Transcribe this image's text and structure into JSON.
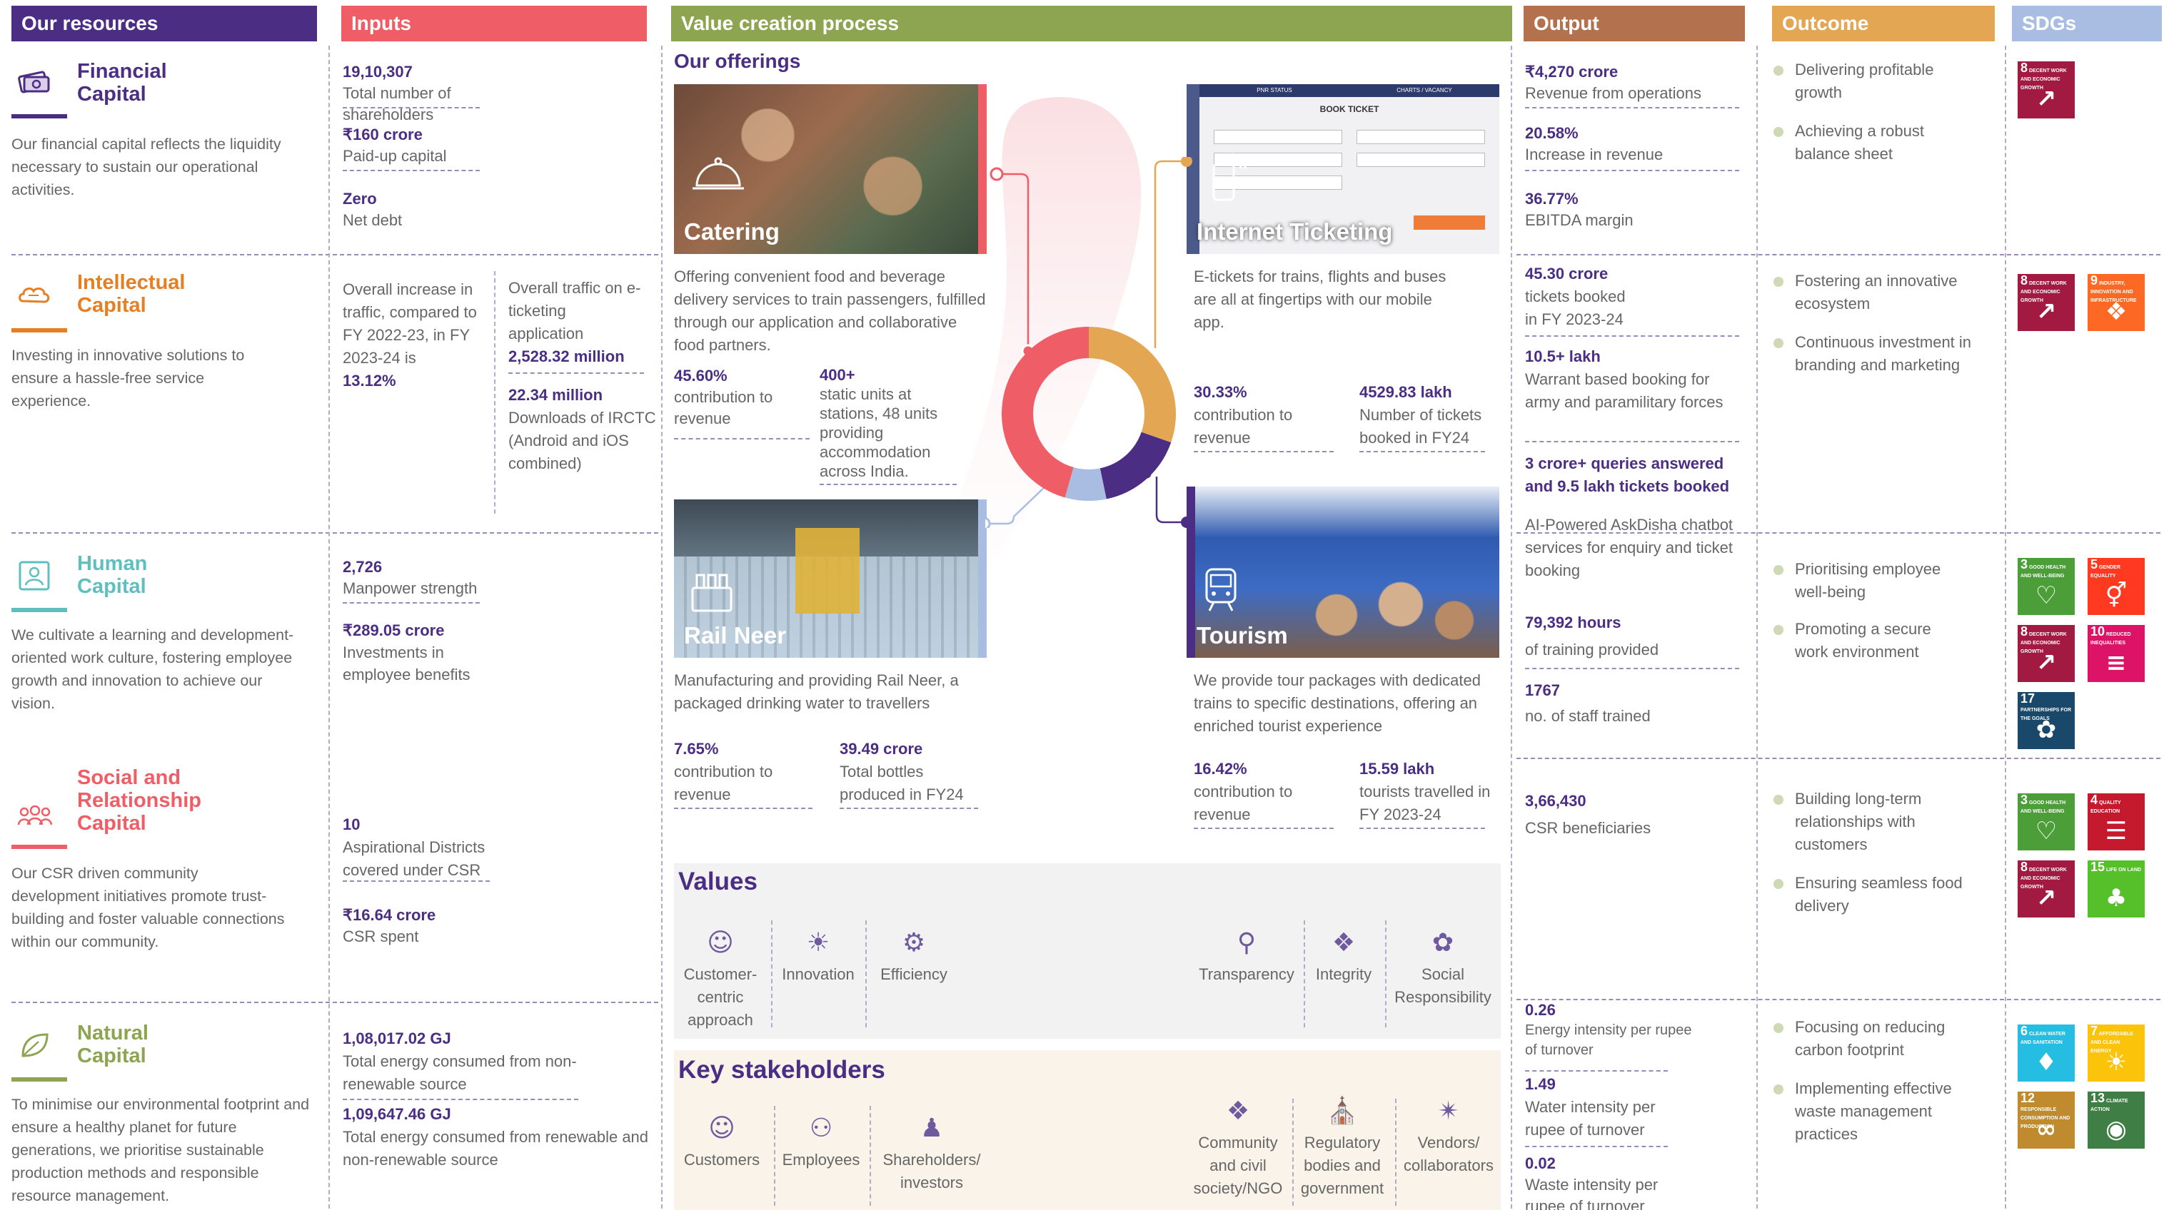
{
  "headers": {
    "resources": "Our resources",
    "inputs": "Inputs",
    "value": "Value creation process",
    "output": "Output",
    "outcome": "Outcome",
    "sdgs": "SDGs"
  },
  "offerings_title": "Our offerings",
  "colors": {
    "purple": "#4b2e83",
    "red": "#ef5d66",
    "green": "#8da550",
    "brown": "#b3714e",
    "orange": "#e3a653",
    "blue": "#a9bde3"
  },
  "capitals": [
    {
      "title": "Financial Capital",
      "desc": "Our financial capital reflects the liquidity necessary to sustain our operational activities.",
      "color": "#4b2e83",
      "icon": "money-icon"
    },
    {
      "title": "Intellectual Capital",
      "desc": "Investing in innovative solutions to ensure a hassle-free service experience.",
      "color": "#e67e22",
      "icon": "brain-icon"
    },
    {
      "title": "Human Capital",
      "desc": "We cultivate a learning and development-oriented work culture, fostering employee growth and innovation to achieve our vision.",
      "color": "#5fbfbf",
      "icon": "person-icon"
    },
    {
      "title": "Social and Relationship Capital",
      "desc": "Our CSR driven community development initiatives promote trust-building and foster valuable connections within our community.",
      "color": "#ef5d66",
      "icon": "people-icon"
    },
    {
      "title": "Natural Capital",
      "desc": "To minimise our environmental footprint and ensure a healthy planet for future generations, we prioritise sustainable production methods and responsible resource management.",
      "color": "#8da550",
      "icon": "leaf-icon"
    }
  ],
  "inputs": {
    "financial": [
      {
        "value": "19,10,307",
        "label": "Total number of shareholders"
      },
      {
        "value": "₹160 crore",
        "label": "Paid-up capital"
      },
      {
        "value": "Zero",
        "label": "Net debt"
      }
    ],
    "intellectual_a": {
      "text": "Overall increase in traffic, compared to FY 2022-23, in FY 2023-24 is",
      "value": "13.12%"
    },
    "intellectual_b": {
      "text": "Overall traffic on e-ticketing application",
      "value": "2,528.32 million"
    },
    "intellectual_c": {
      "value": "22.34 million",
      "label": "Downloads of IRCTC (Android and iOS combined)"
    },
    "human": [
      {
        "value": "2,726",
        "label": "Manpower strength"
      },
      {
        "value": "₹289.05 crore",
        "label": "Investments in employee benefits"
      }
    ],
    "social": [
      {
        "value": "10",
        "label": "Aspirational Districts covered under CSR"
      },
      {
        "value": "₹16.64 crore",
        "label": "CSR spent"
      }
    ],
    "natural": [
      {
        "value": "1,08,017.02 GJ",
        "label": "Total energy consumed from non- renewable source"
      },
      {
        "value": "1,09,647.46 GJ",
        "label": "Total energy consumed from renewable and non-renewable  source"
      }
    ]
  },
  "offerings": {
    "catering": {
      "label": "Catering",
      "desc": "Offering convenient food and beverage delivery services to train passengers, fulfilled through our application and collaborative food partners.",
      "stat1": {
        "value": "45.60%",
        "label": "contribution to revenue"
      },
      "stat2": {
        "value": "400+",
        "label": "static units at stations, 48 units providing accommodation across India."
      }
    },
    "ticketing": {
      "label": "Internet Ticketing",
      "desc": "E-tickets for trains, flights and buses are all at fingertips with our mobile app.",
      "stat1": {
        "value": "30.33%",
        "label": "contribution to revenue"
      },
      "stat2": {
        "value": "4529.83 lakh",
        "label": "Number of tickets booked in FY24"
      },
      "screen_tabs": [
        "PNR STATUS",
        "CHARTS / VACANCY"
      ],
      "screen_title": "BOOK TICKET"
    },
    "railneer": {
      "label": "Rail Neer",
      "desc": "Manufacturing and providing Rail Neer, a packaged drinking water to travellers",
      "stat1": {
        "value": "7.65%",
        "label": "contribution to revenue"
      },
      "stat2": {
        "value": "39.49 crore",
        "label": "Total bottles produced in FY24"
      }
    },
    "tourism": {
      "label": "Tourism",
      "desc": "We provide tour packages with dedicated trains to specific destinations, offering an enriched tourist experience",
      "stat1": {
        "value": "16.42%",
        "label": "contribution to revenue"
      },
      "stat2": {
        "value": "15.59 lakh",
        "label": "tourists travelled in FY 2023-24"
      }
    }
  },
  "donut": {
    "segments": [
      {
        "name": "Catering",
        "value": 45.6,
        "color": "#ef5d66"
      },
      {
        "name": "Internet Ticketing",
        "value": 30.33,
        "color": "#e3a653"
      },
      {
        "name": "Tourism",
        "value": 16.42,
        "color": "#4b2e83"
      },
      {
        "name": "Rail Neer",
        "value": 7.65,
        "color": "#a9bde3"
      }
    ]
  },
  "values": {
    "title": "Values",
    "items": [
      {
        "label": "Customer-centric approach",
        "icon": "customer-icon"
      },
      {
        "label": "Innovation",
        "icon": "bulb-icon"
      },
      {
        "label": "Efficiency",
        "icon": "efficiency-icon"
      },
      {
        "label": "Transparency",
        "icon": "magnifier-icon"
      },
      {
        "label": "Integrity",
        "icon": "integrity-icon"
      },
      {
        "label": "Social Responsibility",
        "icon": "social-icon"
      }
    ]
  },
  "stakeholders": {
    "title": "Key stakeholders",
    "items": [
      {
        "label": "Customers",
        "icon": "customers-icon"
      },
      {
        "label": "Employees",
        "icon": "employees-icon"
      },
      {
        "label": "Shareholders/ investors",
        "icon": "shareholders-icon"
      },
      {
        "label": "Community and civil society/NGO",
        "icon": "community-icon"
      },
      {
        "label": "Regulatory bodies and government",
        "icon": "government-icon"
      },
      {
        "label": "Vendors/ collaborators",
        "icon": "vendors-icon"
      }
    ]
  },
  "outputs": {
    "financial": [
      {
        "value": "₹4,270 crore",
        "label": "Revenue from operations"
      },
      {
        "value": "20.58%",
        "label": "Increase in revenue"
      },
      {
        "value": "36.77%",
        "label": "EBITDA margin"
      }
    ],
    "intellectual": [
      {
        "value": "45.30 crore",
        "label": "tickets booked in FY 2023-24"
      },
      {
        "value": "10.5+ lakh",
        "label": "Warrant based booking for army and paramilitary forces"
      },
      {
        "value": "3 crore+ queries answered and 9.5 lakh tickets booked",
        "label": ""
      },
      {
        "value": "",
        "label": "AI-Powered AskDisha chatbot services for enquiry and ticket booking"
      }
    ],
    "human": [
      {
        "value": "79,392 hours",
        "label": "of training provided"
      },
      {
        "value": "1767",
        "label": "no. of staff trained"
      }
    ],
    "social": [
      {
        "value": "3,66,430",
        "label": "CSR beneficiaries"
      }
    ],
    "natural": [
      {
        "value": "0.26",
        "label": "Energy intensity per rupee of turnover"
      },
      {
        "value": "1.49",
        "label": "Water intensity per rupee of turnover"
      },
      {
        "value": "0.02",
        "label": "Waste intensity per rupee of turnover"
      }
    ]
  },
  "outcomes": {
    "financial": [
      "Delivering profitable growth",
      "Achieving a robust balance sheet"
    ],
    "intellectual": [
      "Fostering an innovative ecosystem",
      "Continuous investment in branding and marketing"
    ],
    "human": [
      "Prioritising employee well-being",
      "Promoting a secure work environment"
    ],
    "social": [
      "Building long-term relationships with customers",
      "Ensuring seamless food delivery"
    ],
    "natural": [
      "Focusing on reducing carbon footprint",
      "Implementing effective waste management practices"
    ]
  },
  "sdgs": {
    "financial": [
      {
        "n": "8",
        "t": "DECENT WORK AND ECONOMIC GROWTH",
        "c": "#a21942",
        "icon": "growth-icon"
      }
    ],
    "intellectual": [
      {
        "n": "8",
        "t": "DECENT WORK AND ECONOMIC GROWTH",
        "c": "#a21942",
        "icon": "growth-icon"
      },
      {
        "n": "9",
        "t": "INDUSTRY, INNOVATION AND INFRASTRUCTURE",
        "c": "#fd6925",
        "icon": "cube-icon"
      }
    ],
    "human": [
      {
        "n": "3",
        "t": "GOOD HEALTH AND WELL-BEING",
        "c": "#4c9f38",
        "icon": "heartbeat-icon"
      },
      {
        "n": "5",
        "t": "GENDER EQUALITY",
        "c": "#ff3a21",
        "icon": "gender-icon"
      },
      {
        "n": "8",
        "t": "DECENT WORK AND ECONOMIC GROWTH",
        "c": "#a21942",
        "icon": "growth-icon"
      },
      {
        "n": "10",
        "t": "REDUCED INEQUALITIES",
        "c": "#dd1367",
        "icon": "equal-icon"
      },
      {
        "n": "17",
        "t": "PARTNERSHIPS FOR THE GOALS",
        "c": "#19486a",
        "icon": "flower-icon"
      }
    ],
    "social": [
      {
        "n": "3",
        "t": "GOOD HEALTH AND WELL-BEING",
        "c": "#4c9f38",
        "icon": "heartbeat-icon"
      },
      {
        "n": "4",
        "t": "QUALITY EDUCATION",
        "c": "#c5192d",
        "icon": "book-icon"
      },
      {
        "n": "8",
        "t": "DECENT WORK AND ECONOMIC GROWTH",
        "c": "#a21942",
        "icon": "growth-icon"
      },
      {
        "n": "15",
        "t": "LIFE ON LAND",
        "c": "#56c02b",
        "icon": "tree-icon"
      }
    ],
    "natural": [
      {
        "n": "6",
        "t": "CLEAN WATER AND SANITATION",
        "c": "#26bde2",
        "icon": "water-icon"
      },
      {
        "n": "7",
        "t": "AFFORDABLE AND CLEAN ENERGY",
        "c": "#fcc30b",
        "icon": "sun-icon"
      },
      {
        "n": "12",
        "t": "RESPONSIBLE CONSUMPTION AND PRODUCTION",
        "c": "#bf8b2e",
        "icon": "infinity-icon"
      },
      {
        "n": "13",
        "t": "CLIMATE ACTION",
        "c": "#3f7e44",
        "icon": "eye-icon"
      }
    ]
  }
}
